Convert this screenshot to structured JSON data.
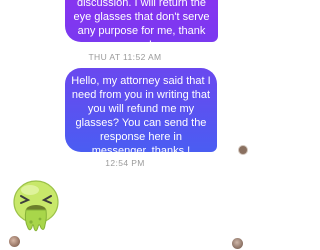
{
  "messages": [
    {
      "text": "discussion. I will return the eye glasses that don't serve any purpose for me, thank you!",
      "direction": "outgoing"
    },
    {
      "text": "Hello,  my attorney said that I need from you in writing that you will refund me my glasses? You can send the response here in messenger,  thanks !",
      "direction": "outgoing"
    }
  ],
  "timestamps": [
    "THU AT 11:52 AM",
    "12:54 PM"
  ],
  "sticker": {
    "icon": "sick-face-sticker"
  },
  "colors": {
    "bubble_top": "#7f38f0",
    "bubble_mid": "#5555f0",
    "timestamp": "#9a9a9a",
    "sticker_green": "#c8e86a"
  }
}
